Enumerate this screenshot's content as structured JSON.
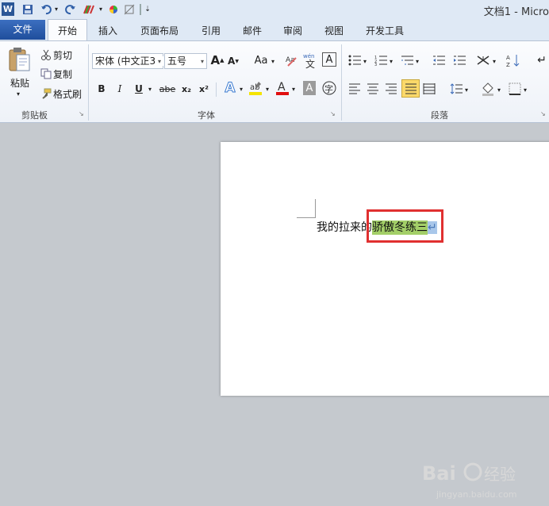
{
  "window": {
    "title": "文档1 - Micro"
  },
  "quick_access": {
    "word_logo": "W",
    "save_icon": "save-icon",
    "undo_icon": "undo-icon",
    "redo_icon": "redo-icon"
  },
  "tabs": [
    {
      "label": "文件"
    },
    {
      "label": "开始"
    },
    {
      "label": "插入"
    },
    {
      "label": "页面布局"
    },
    {
      "label": "引用"
    },
    {
      "label": "邮件"
    },
    {
      "label": "审阅"
    },
    {
      "label": "视图"
    },
    {
      "label": "开发工具"
    }
  ],
  "clipboard": {
    "paste_label": "粘贴",
    "cut_label": "剪切",
    "copy_label": "复制",
    "format_painter_label": "格式刷",
    "group_label": "剪贴板"
  },
  "font": {
    "font_name": "宋体 (中文正3",
    "font_size": "五号",
    "change_case": "Aa",
    "bold": "B",
    "italic": "I",
    "underline": "U",
    "strikethrough": "abe",
    "subscript": "x₂",
    "superscript": "x²",
    "group_label": "字体"
  },
  "paragraph": {
    "group_label": "段落"
  },
  "document": {
    "text_before": "我的拉来的",
    "text_highlighted": "骄傲冬练三",
    "paragraph_mark": "↵"
  },
  "watermark": {
    "brand": "Baidu经验",
    "url": "jingyan.baidu.com"
  },
  "colors": {
    "file_tab": "#2b579a",
    "highlight": "#a3cf68",
    "callout": "#e03030"
  }
}
